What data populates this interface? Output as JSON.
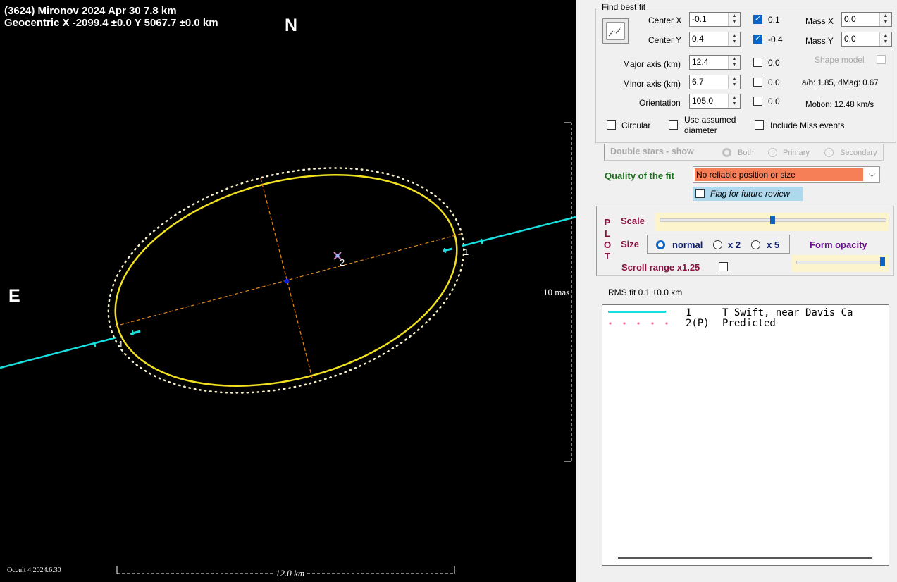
{
  "plot": {
    "title_line1": "(3624) Mironov  2024 Apr 30   7.8 km",
    "title_line2": "Geocentric  X  -2099.4 ±0.0  Y 5067.7 ±0.0 km",
    "north_label": "N",
    "east_label": "E",
    "scale_mas_label": "10 mas",
    "scale_km_label": "12.0 km",
    "version_label": "Occult 4.2024.6.30",
    "chord_label_1a": "1",
    "chord_label_1b": "1",
    "point_label_2": "2",
    "colors": {
      "background": "#000000",
      "ellipse": "#f0e020",
      "predicted_outline": "#f5f0c8",
      "axes": "#e08a1e",
      "chord": "#19e0e0",
      "center": "#1020d0"
    }
  },
  "fit": {
    "group_title": "Find best fit",
    "center_x": {
      "label": "Center X",
      "value": "-0.1",
      "check_label": "0.1"
    },
    "center_y": {
      "label": "Center Y",
      "value": "0.4",
      "check_label": "-0.4"
    },
    "mass_x": {
      "label": "Mass X",
      "value": "0.0"
    },
    "mass_y": {
      "label": "Mass Y",
      "value": "0.0"
    },
    "shape_model_label": "Shape model",
    "major_axis": {
      "label": "Major axis (km)",
      "value": "12.4",
      "check_label": "0.0"
    },
    "minor_axis": {
      "label": "Minor axis (km)",
      "value": "6.7",
      "check_label": "0.0"
    },
    "orientation": {
      "label": "Orientation",
      "value": "105.0",
      "check_label": "0.0"
    },
    "ab_text": "a/b: 1.85, dMag: 0.67",
    "motion_text": "Motion: 12.48 km/s",
    "circular_label": "Circular",
    "assumed_line1": "Use assumed",
    "assumed_line2": "diameter",
    "include_miss_label": "Include Miss events",
    "double_stars_label": "Double stars - show",
    "both_label": "Both",
    "primary_label": "Primary",
    "secondary_label": "Secondary",
    "quality_label": "Quality of the fit",
    "quality_value": "No reliable position or size",
    "quality_color": "#f77f58",
    "flag_label": "Flag for future review"
  },
  "plot_controls": {
    "plot_letters": [
      "P",
      "L",
      "O",
      "T"
    ],
    "scale_label": "Scale",
    "size_label": "Size",
    "size_options": [
      "normal",
      "x 2",
      "x 5"
    ],
    "form_opacity_label": "Form opacity",
    "scroll_range_label": "Scroll range x1.25"
  },
  "rms_text": "RMS fit 0.1 ±0.0 km",
  "legend": [
    {
      "num": "1",
      "text": "T Swift, near Davis Ca",
      "style": "line",
      "color": "#19e0e0"
    },
    {
      "num": "2(P)",
      "text": "Predicted",
      "style": "dots",
      "color": "#f06aa0"
    }
  ]
}
